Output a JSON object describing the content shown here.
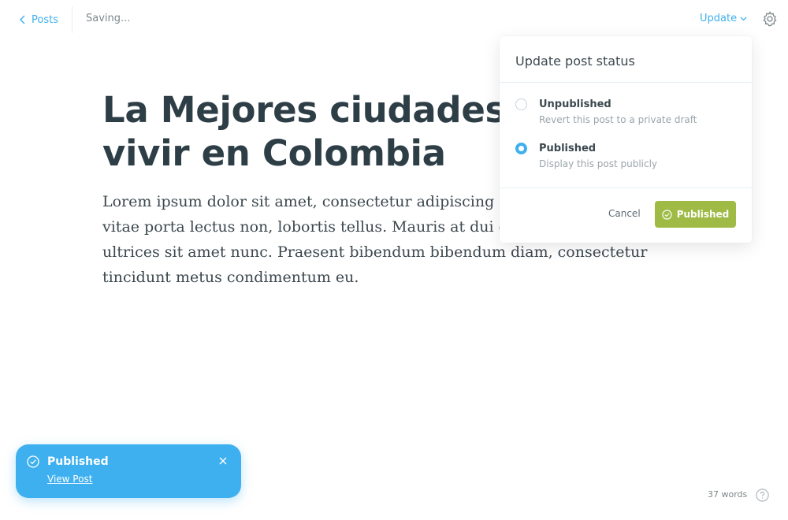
{
  "header": {
    "back_label": "Posts",
    "status": "Saving...",
    "update_label": "Update"
  },
  "editor": {
    "title": "La Mejores ciudades para vivir en Colombia",
    "body": "Lorem ipsum dolor sit amet, consectetur adipiscing elit. Fusce mollis ex vitae porta lectus non, lobortis tellus. Mauris at dui eget ante volutpat ultrices sit amet nunc. Praesent bibendum bibendum diam, consectetur tincidunt metus condimentum eu."
  },
  "popover": {
    "title": "Update post status",
    "options": [
      {
        "label": "Unpublished",
        "description": "Revert this post to a private draft",
        "selected": false
      },
      {
        "label": "Published",
        "description": "Display this post publicly",
        "selected": true
      }
    ],
    "cancel_label": "Cancel",
    "confirm_label": "Published"
  },
  "toast": {
    "title": "Published",
    "link": "View Post"
  },
  "footer": {
    "word_count": "37 words"
  },
  "icons": [
    "chevron-left-icon",
    "chevron-down-icon",
    "gear-icon",
    "check-circle-icon",
    "close-icon",
    "help-icon"
  ],
  "colors": {
    "accent": "#3eb0ef",
    "publish_green": "#9fbb46",
    "text_dark": "#2e3e46",
    "muted": "#7d878a"
  }
}
